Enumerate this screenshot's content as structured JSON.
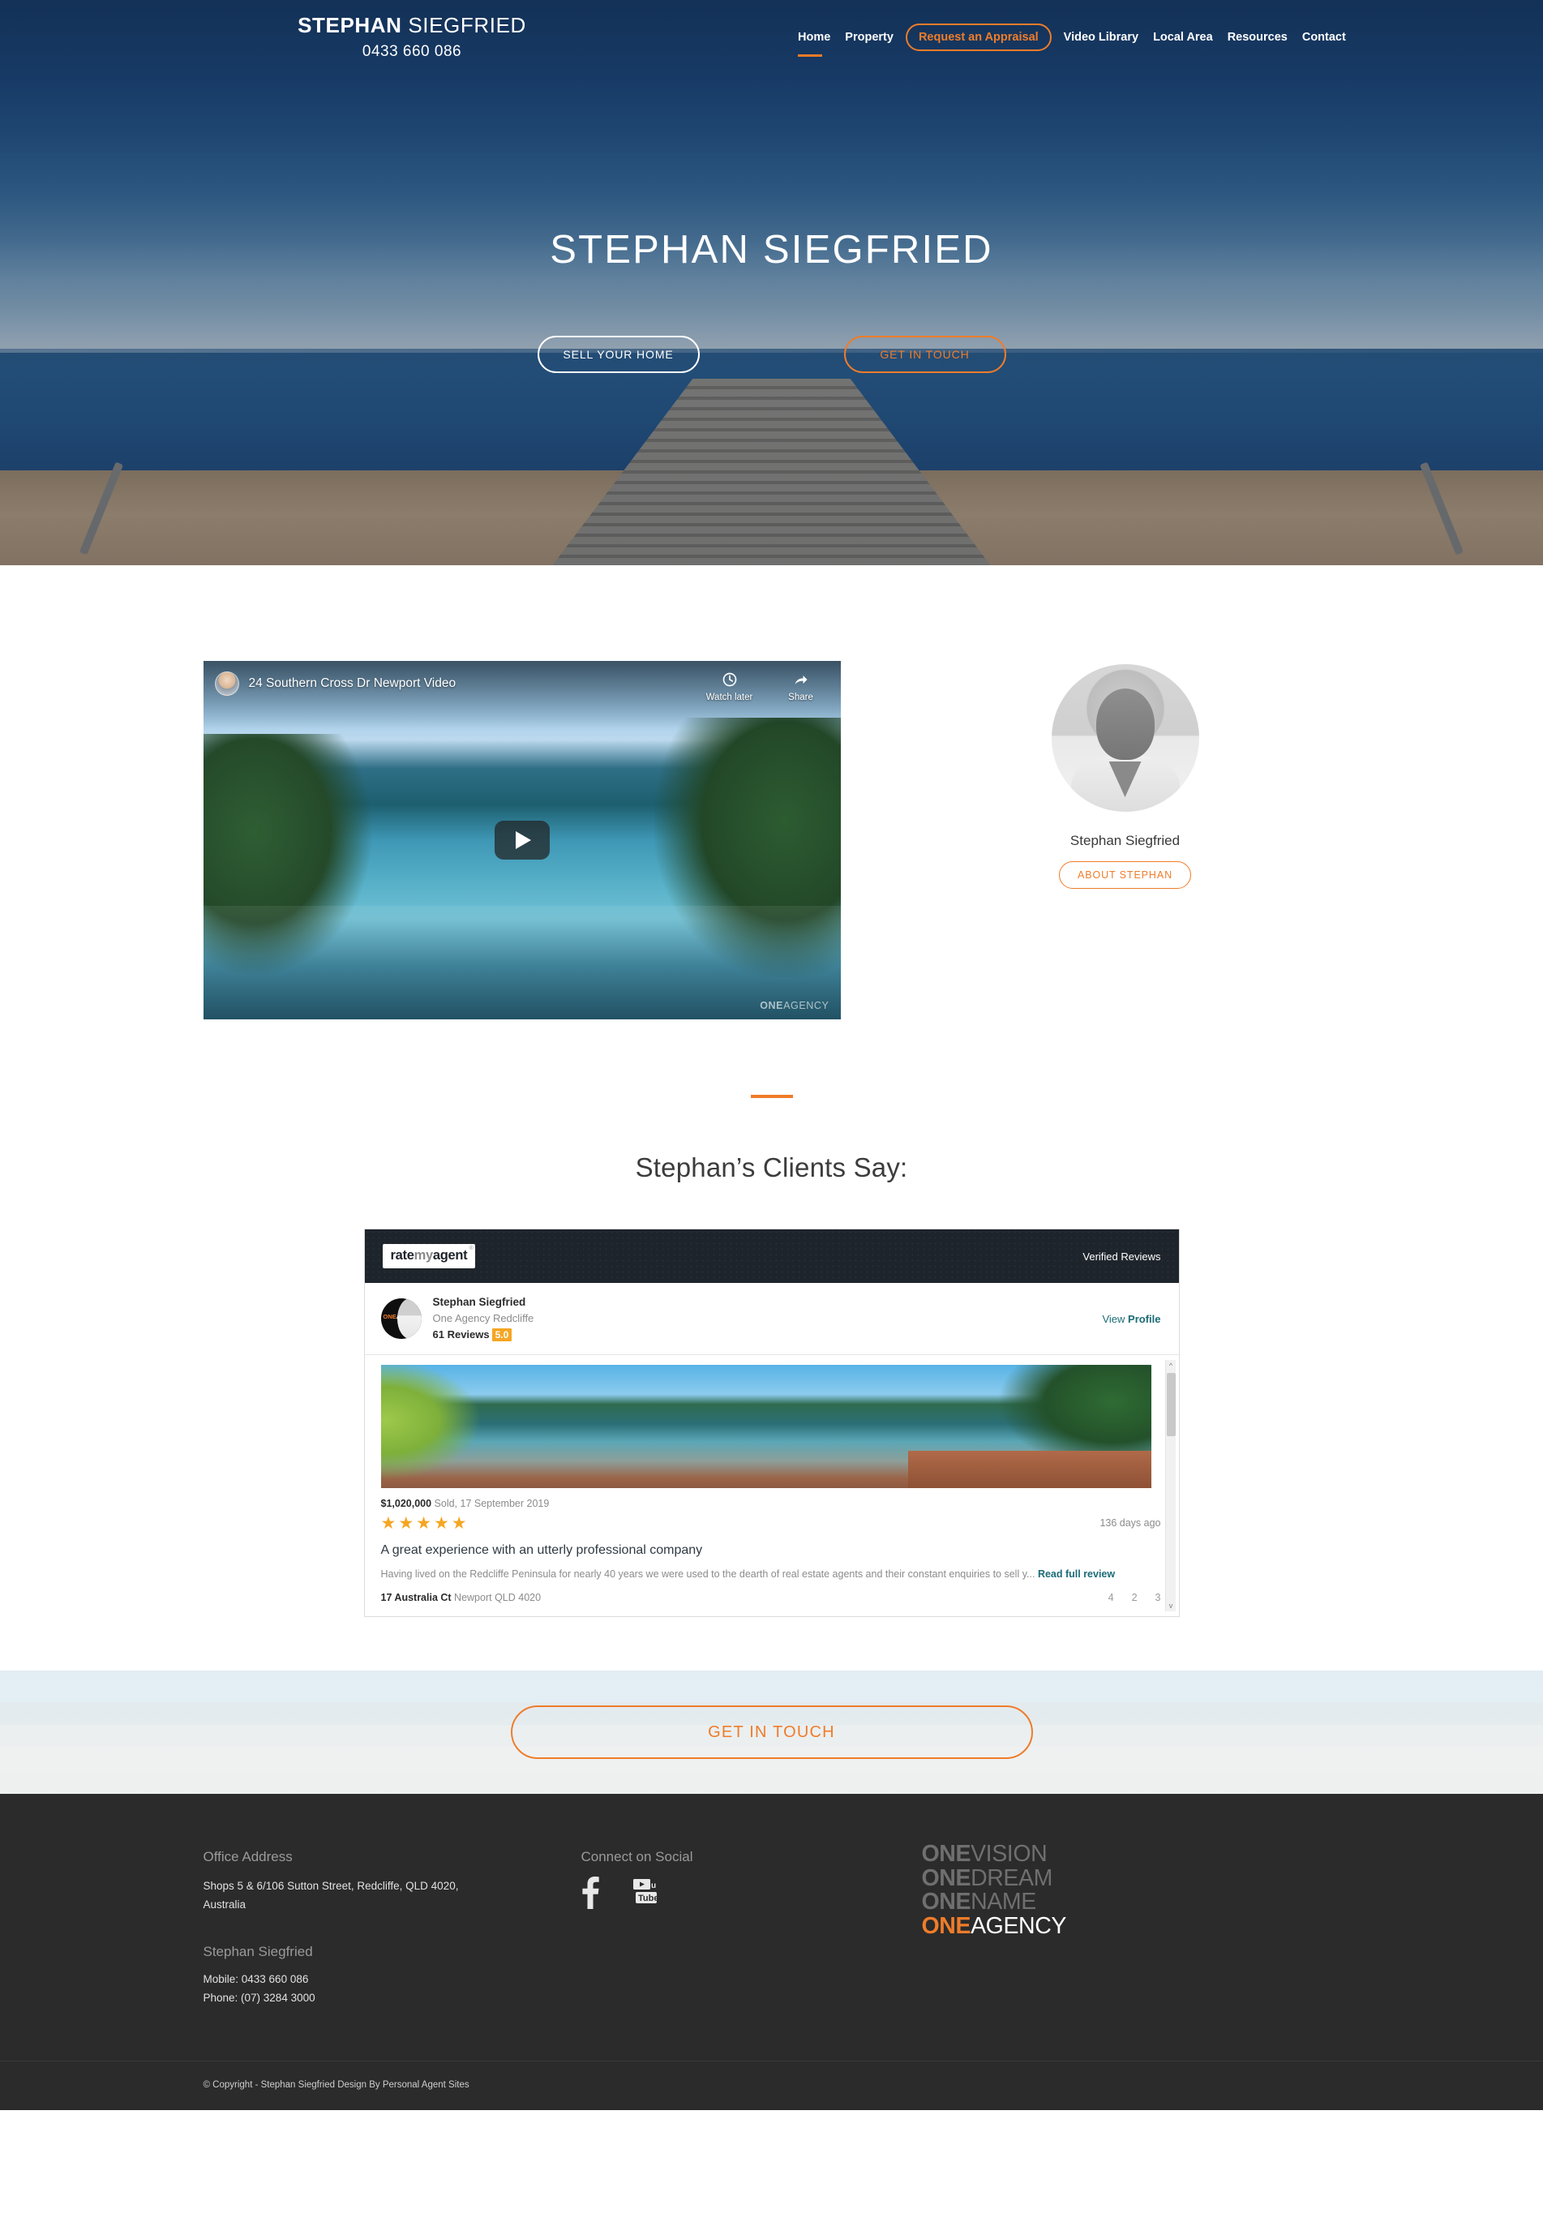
{
  "header": {
    "brand_first": "STEPHAN",
    "brand_last": " SIEGFRIED",
    "phone": "0433 660 086",
    "nav": [
      {
        "label": "Home",
        "style": "active"
      },
      {
        "label": "Property",
        "style": "plain"
      },
      {
        "label": "Request an Appraisal",
        "style": "pill"
      },
      {
        "label": "Video Library",
        "style": "plain"
      },
      {
        "label": "Local Area",
        "style": "plain"
      },
      {
        "label": "Resources",
        "style": "plain"
      },
      {
        "label": "Contact",
        "style": "plain"
      }
    ]
  },
  "hero": {
    "title": "STEPHAN SIEGFRIED",
    "btn_primary": "SELL YOUR HOME",
    "btn_secondary": "GET IN TOUCH"
  },
  "video": {
    "title": "24 Southern Cross Dr Newport Video",
    "watch_later": "Watch later",
    "share": "Share",
    "watermark_one": "ONE",
    "watermark_agency": "AGENCY"
  },
  "agent": {
    "name": "Stephan Siegfried",
    "about_button": "ABOUT STEPHAN"
  },
  "testimonials": {
    "heading": "Stephan’s Clients Say:",
    "widget": {
      "logo_rate": "rate",
      "logo_my": "my",
      "logo_agent": "agent",
      "logo_tm": "®",
      "verified": "Verified Reviews",
      "agent_name": "Stephan Siegfried",
      "agency": "One Agency Redcliffe",
      "reviews_count": "61 Reviews",
      "rating": "5.0",
      "view_profile_light": "View ",
      "view_profile_bold": "Profile",
      "avatar_logo_one": "ONE",
      "avatar_logo_agency": "AGEN",
      "review": {
        "price": "$1,020,000",
        "sold": " Sold, 17 September 2019",
        "stars": "★★★★★",
        "days_ago": "136 days ago",
        "title": "A great experience with an utterly professional company",
        "excerpt": "Having lived on the Redcliffe Peninsula for nearly 40 years we were used to the dearth of real estate agents and their constant enquiries to sell y... ",
        "read_more": "Read full review",
        "address_street": "17 Australia Ct",
        "address_rest": " Newport QLD 4020",
        "beds": "4",
        "baths": "2",
        "cars": "3"
      }
    }
  },
  "cta": {
    "label": "GET IN TOUCH"
  },
  "footer": {
    "office_heading": "Office Address",
    "office_address": "Shops 5 & 6/106 Sutton Street, Redcliffe, QLD 4020, Australia",
    "agent_heading": "Stephan Siegfried",
    "mobile": "Mobile: 0433 660 086",
    "phone": "Phone: (07) 3284 3000",
    "social_heading": "Connect on Social",
    "logo": {
      "l1_one": "ONE",
      "l1_word": "VISION",
      "l2_one": "ONE",
      "l2_word": "DREAM",
      "l3_one": "ONE",
      "l3_word": "NAME",
      "l4_one": "ONE",
      "l4_word": "AGENCY"
    },
    "copyright": "© Copyright - Stephan Siegfried Design By Personal Agent Sites"
  },
  "colors": {
    "accent": "#ef7c2a",
    "navy": "#1b3f6b",
    "footer_bg": "#2b2b2b",
    "star": "#f5a623",
    "teal_link": "#1b6b76"
  }
}
